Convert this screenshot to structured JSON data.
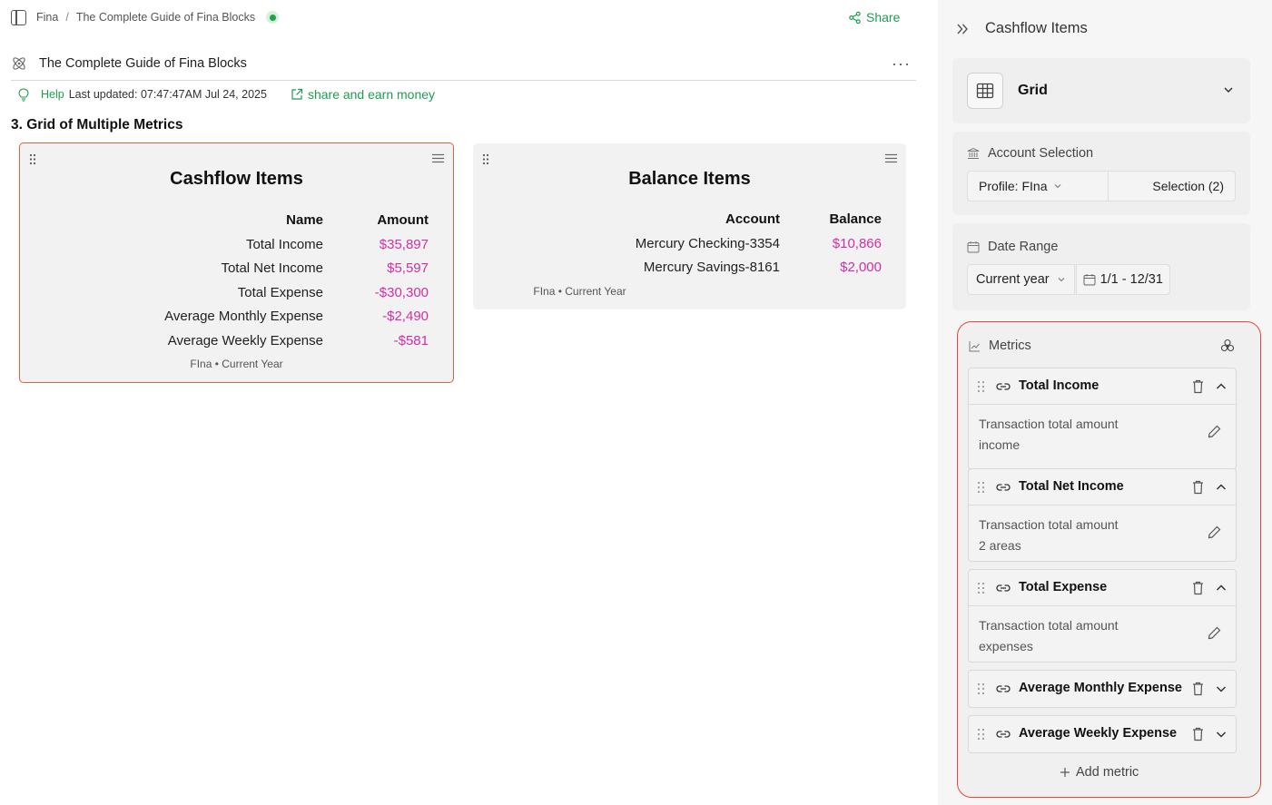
{
  "breadcrumb": {
    "root": "Fina",
    "separator": "/",
    "page": "The Complete Guide of Fina Blocks"
  },
  "toolbar": {
    "share_label": "Share"
  },
  "doc": {
    "title": "The Complete Guide of Fina Blocks",
    "help_label": "Help",
    "last_updated": "Last updated: 07:47:47AM Jul 24, 2025",
    "share_earn_label": "share and earn money",
    "section_heading": "3. Grid of Multiple Metrics"
  },
  "cards": {
    "cashflow": {
      "title": "Cashflow Items",
      "columns": [
        "Name",
        "Amount"
      ],
      "rows": [
        {
          "name": "Total Income",
          "amount": "$35,897"
        },
        {
          "name": "Total Net Income",
          "amount": "$5,597"
        },
        {
          "name": "Total Expense",
          "amount": "-$30,300"
        },
        {
          "name": "Average Monthly Expense",
          "amount": "-$2,490"
        },
        {
          "name": "Average Weekly Expense",
          "amount": "-$581"
        }
      ],
      "footer": "FIna • Current Year"
    },
    "balance": {
      "title": "Balance Items",
      "columns": [
        "Account",
        "Balance"
      ],
      "rows": [
        {
          "name": "Mercury Checking-3354",
          "amount": "$10,866"
        },
        {
          "name": "Mercury Savings-8161",
          "amount": "$2,000"
        }
      ],
      "footer": "FIna • Current Year"
    }
  },
  "panel": {
    "title": "Cashflow Items",
    "view_type": "Grid",
    "account_selection": {
      "label": "Account Selection",
      "profile": "Profile: FIna",
      "selection": "Selection (2)"
    },
    "date_range": {
      "label": "Date Range",
      "preset": "Current year",
      "range": "1/1 - 12/31"
    },
    "metrics": {
      "label": "Metrics",
      "items": [
        {
          "name": "Total Income",
          "desc_line1": "Transaction total amount",
          "desc_line2": "income"
        },
        {
          "name": "Total Net Income",
          "desc_line1": "Transaction total amount",
          "desc_line2": "2 areas"
        },
        {
          "name": "Total Expense",
          "desc_line1": "Transaction total amount",
          "desc_line2": "expenses"
        },
        {
          "name": "Average Monthly Expense"
        },
        {
          "name": "Average Weekly Expense"
        }
      ],
      "add_label": "Add metric"
    }
  },
  "colors": {
    "brand_green": "#1f9e4f",
    "value_magenta": "#d22fa5",
    "highlight_red": "#e04a3a"
  }
}
